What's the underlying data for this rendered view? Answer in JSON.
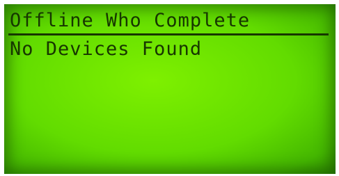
{
  "screen": {
    "title": "Offline Who Complete",
    "message": "No Devices Found"
  },
  "colors": {
    "lcd_background": "#62dc00",
    "lcd_text": "#173600"
  }
}
